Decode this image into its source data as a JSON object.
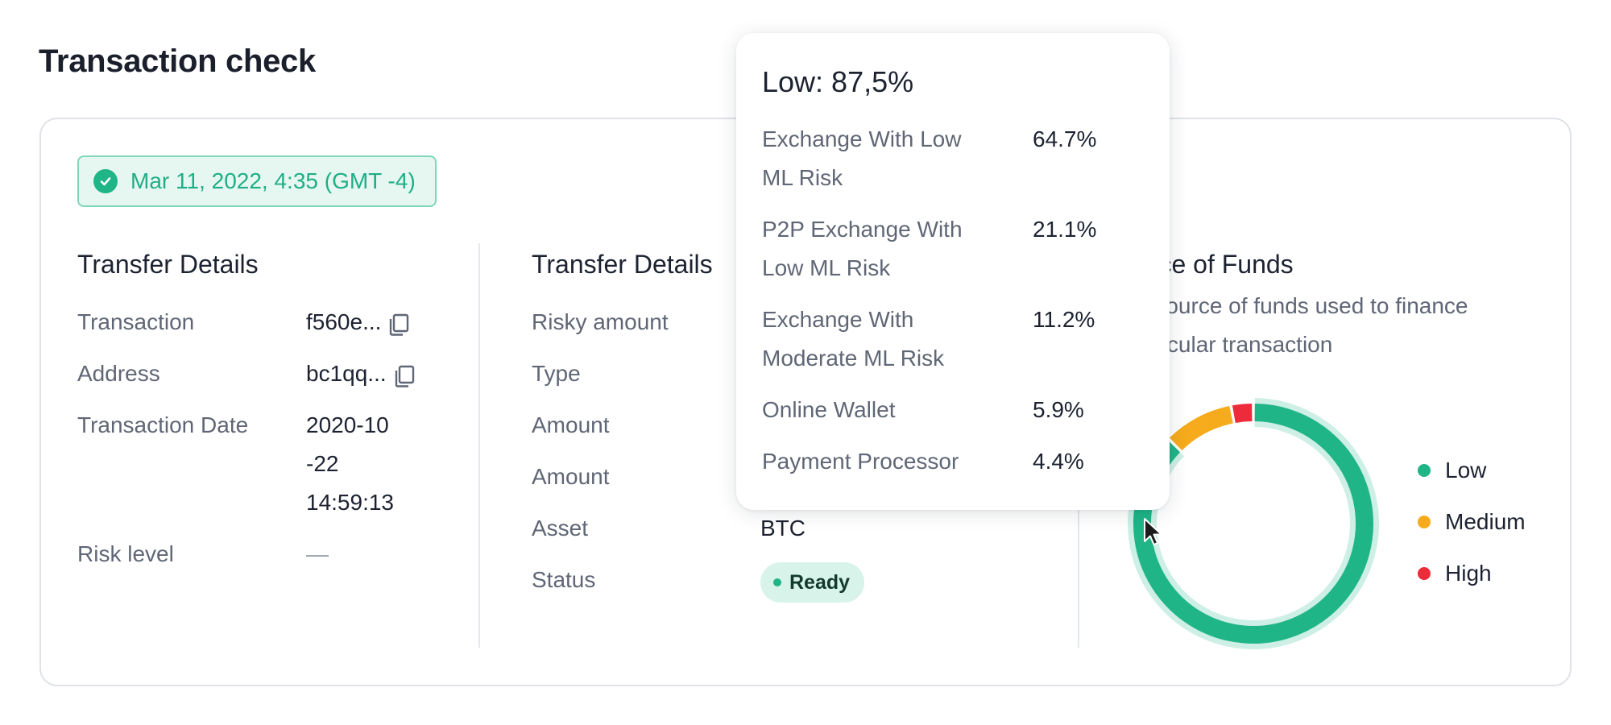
{
  "page_title": "Transaction check",
  "date_badge": "Mar 11, 2022,  4:35 (GMT -4)",
  "col1": {
    "title": "Transfer Details",
    "rows": [
      {
        "label": "Transaction",
        "value": "f560e..."
      },
      {
        "label": "Address",
        "value": "bc1qq..."
      },
      {
        "label": "Transaction Date",
        "value_lines": [
          "2020-10",
          "-22",
          "14:59:13"
        ]
      },
      {
        "label": "Risk level",
        "value": "—"
      }
    ]
  },
  "col2": {
    "title": "Transfer Details",
    "rows": [
      {
        "label": "Risky amount"
      },
      {
        "label": "Type"
      },
      {
        "label": "Amount"
      },
      {
        "label": "Amount"
      },
      {
        "label": "Asset",
        "value": "BTC"
      },
      {
        "label": "Status",
        "value": "Ready"
      }
    ]
  },
  "col3": {
    "title": "urce of Funds",
    "desc_line1": "e source of funds used to finance",
    "desc_line2": "articular transaction",
    "legend": [
      {
        "label": "Low",
        "color": "#1fb587"
      },
      {
        "label": "Medium",
        "color": "#f5ab1b"
      },
      {
        "label": "High",
        "color": "#ee2b3b"
      }
    ]
  },
  "chart_data": {
    "type": "pie",
    "variant": "donut",
    "categories": [
      "Low",
      "Medium",
      "High"
    ],
    "values": [
      87.5,
      9.5,
      3.0
    ],
    "colors": [
      "#1fb587",
      "#f5ab1b",
      "#ee2b3b"
    ],
    "hovered_category": "Low"
  },
  "tooltip": {
    "title": "Low: 87,5%",
    "items": [
      {
        "label_lines": [
          "Exchange With Low",
          "ML Risk"
        ],
        "value": "64.7%"
      },
      {
        "label_lines": [
          "P2P Exchange With",
          "Low ML Risk"
        ],
        "value": "21.1%"
      },
      {
        "label_lines": [
          "Exchange With",
          "Moderate ML Risk"
        ],
        "value": "11.2%"
      },
      {
        "label_lines": [
          "Online Wallet"
        ],
        "value": "5.9%"
      },
      {
        "label_lines": [
          "Payment Processor"
        ],
        "value": "4.4%"
      }
    ]
  }
}
